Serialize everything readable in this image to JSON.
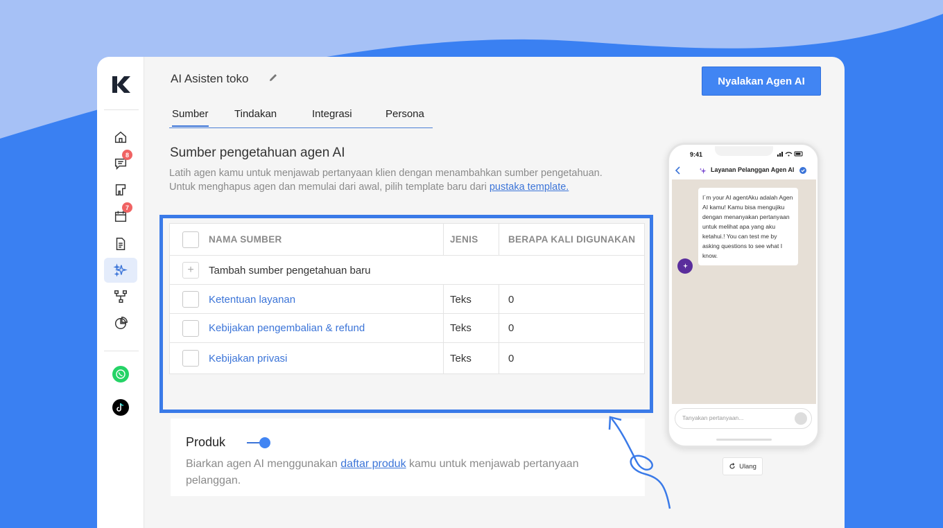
{
  "page": {
    "title": "AI Asisten toko",
    "cta_label": "Nyalakan Agen AI"
  },
  "tabs": [
    {
      "label": "Sumber",
      "active": true
    },
    {
      "label": "Tindakan",
      "active": false
    },
    {
      "label": "Integrasi",
      "active": false
    },
    {
      "label": "Persona",
      "active": false
    }
  ],
  "sidebar": {
    "items": [
      {
        "icon": "home-icon"
      },
      {
        "icon": "chat-icon",
        "badge": "8"
      },
      {
        "icon": "kanban-icon"
      },
      {
        "icon": "calendar-icon",
        "badge": "7"
      },
      {
        "icon": "document-icon"
      },
      {
        "icon": "ai-sparkle-icon",
        "active": true
      },
      {
        "icon": "workflow-icon"
      },
      {
        "icon": "pie-chart-icon"
      }
    ],
    "channels": [
      {
        "icon": "whatsapp-icon"
      },
      {
        "icon": "tiktok-icon"
      }
    ]
  },
  "section": {
    "heading": "Sumber pengetahuan agen AI",
    "desc_line1": "Latih agen kamu untuk menjawab pertanyaan klien dengan menambahkan sumber pengetahuan.",
    "desc_line2": "Untuk menghapus agen dan memulai dari awal, pilih template baru dari ",
    "desc_link": "pustaka template."
  },
  "table": {
    "headers": [
      "NAMA SUMBER",
      "JENIS",
      "BERAPA KALI DIGUNAKAN"
    ],
    "add_label": "Tambah sumber pengetahuan baru",
    "rows": [
      {
        "name": "Ketentuan layanan",
        "type": "Teks",
        "count": "0"
      },
      {
        "name": "Kebijakan pengembalian & refund",
        "type": "Teks",
        "count": "0"
      },
      {
        "name": "Kebijakan privasi",
        "type": "Teks",
        "count": "0"
      }
    ]
  },
  "produk": {
    "title": "Produk",
    "toggle_on": true,
    "desc_before": "Biarkan agen AI menggunakan ",
    "desc_link": "daftar produk",
    "desc_after": " kamu untuk menjawab pertanyaan pelanggan."
  },
  "phone": {
    "time": "9:41",
    "chat_name": "Layanan Pelanggan Agen AI",
    "message": "I´m your AI agentAku adalah Agen AI kamu! Kamu bisa mengujiku dengan menanyakan pertanyaan untuk melihat apa yang aku ketahui.! You can test me by asking questions to see what I know.",
    "input_placeholder": "Tanyakan pertanyaan...",
    "reset_label": "Ulang"
  },
  "colors": {
    "accent": "#4185f3",
    "link": "#3b74d8",
    "badge": "#f06363",
    "highlight": "#3a7ae8"
  }
}
